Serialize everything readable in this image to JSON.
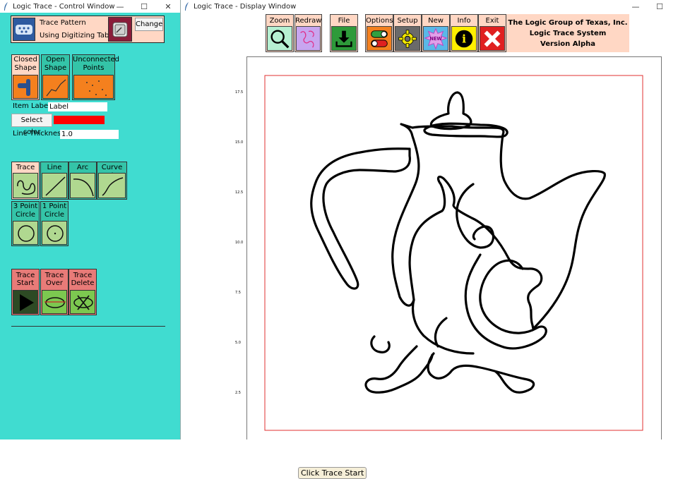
{
  "control_window": {
    "title": "Logic Trace - Control Window",
    "win_controls": [
      "—",
      "☐",
      "✕"
    ],
    "pattern": {
      "line1": "Trace Pattern",
      "line2": "Using Digitizing Tablet",
      "change_label": "Change"
    },
    "shapes": [
      {
        "line1": "Closed",
        "line2": "Shape"
      },
      {
        "line1": "Open",
        "line2": "Shape"
      },
      {
        "line1": "Unconnected",
        "line2": "Points"
      }
    ],
    "item_label": {
      "label": "Item Label:",
      "value": "Label"
    },
    "select_color": {
      "label": "Select color",
      "color": "#ff0000"
    },
    "line_thickness": {
      "label": "Line Thickness:",
      "value": "1.0"
    },
    "tools": [
      {
        "line1": "Trace",
        "line2": ""
      },
      {
        "line1": "Line",
        "line2": ""
      },
      {
        "line1": "Arc",
        "line2": ""
      },
      {
        "line1": "Curve Fit",
        "line2": ""
      },
      {
        "line1": "3 Point",
        "line2": "Circle"
      },
      {
        "line1": "1 Point",
        "line2": "Circle"
      }
    ],
    "actions": [
      {
        "line1": "Trace",
        "line2": "Start"
      },
      {
        "line1": "Trace",
        "line2": "Over"
      },
      {
        "line1": "Trace",
        "line2": "Delete"
      }
    ]
  },
  "display_window": {
    "title": "Logic Trace - Display Window",
    "win_controls": [
      "—",
      "☐"
    ],
    "toolbar": [
      {
        "label": "Zoom",
        "icon": "magnifier-icon"
      },
      {
        "label": "Redraw",
        "icon": "redraw-icon"
      },
      {
        "label": "File",
        "icon": "download-icon"
      },
      {
        "label": "Options",
        "icon": "toggle-icon"
      },
      {
        "label": "Setup",
        "icon": "gear-icon"
      },
      {
        "label": "New",
        "icon": "new-burst-icon",
        "badge": "NEW"
      },
      {
        "label": "Info",
        "icon": "info-icon",
        "glyph": "i"
      },
      {
        "label": "Exit",
        "icon": "close-x-icon"
      }
    ],
    "company": {
      "line1": "The Logic Group of Texas, Inc.",
      "line2": "Logic Trace System",
      "line3": "Version Alpha"
    },
    "plot": {
      "y_ticks": [
        "17.5",
        "15.0",
        "12.5",
        "10.0",
        "7.5",
        "5.0",
        "2.5"
      ],
      "frame_color": "#e03030"
    },
    "status": "Click Trace Start"
  }
}
